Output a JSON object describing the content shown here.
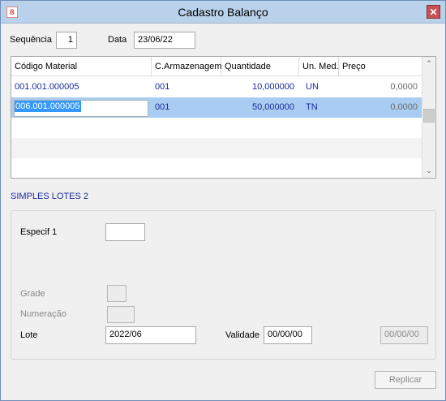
{
  "window": {
    "title": "Cadastro Balanço",
    "app_icon": "app-logo-icon",
    "close_glyph": "✕"
  },
  "header": {
    "sequencia_label": "Sequência",
    "sequencia_value": "1",
    "data_label": "Data",
    "data_value": "23/06/22"
  },
  "grid": {
    "columns": [
      "Código Material",
      "C.Armazenagem",
      "Quantidade",
      "Un. Med.",
      "Preço"
    ],
    "rows": [
      {
        "codigo": "001.001.000005",
        "armazenagem": "001",
        "quantidade": "10,000000",
        "unidade": "UN",
        "preco": "0,0000"
      },
      {
        "codigo": "006.001.000005",
        "armazenagem": "001",
        "quantidade": "50,000000",
        "unidade": "TN",
        "preco": "0,0000"
      }
    ],
    "scroll_up_glyph": "⌃",
    "scroll_down_glyph": "⌄"
  },
  "lotes": {
    "section_title": "SIMPLES LOTES 2",
    "especif_label": "Especif 1",
    "especif_value": "",
    "grade_label": "Grade",
    "grade_value": "",
    "numeracao_label": "Numeração",
    "numeracao_value": "",
    "lote_label": "Lote",
    "lote_value": "2022/06",
    "validade_label": "Validade",
    "validade_value": "00/00/00",
    "validade2_value": "00/00/00"
  },
  "footer": {
    "replicar_label": "Replicar"
  },
  "colors": {
    "titlebar": "#b9d1ea",
    "selected_row": "#a9cdf2",
    "data_text": "#1a2a9c",
    "close_button": "#c75050"
  }
}
